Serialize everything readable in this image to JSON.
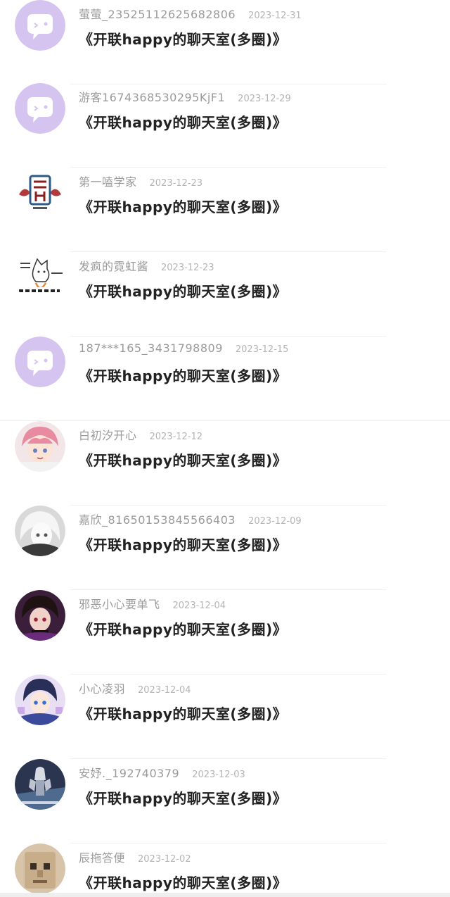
{
  "messages": [
    {
      "username": "萤萤_23525112625682806",
      "date": "2023-12-31",
      "text": "《开联happy的聊天室(多圈)》",
      "avatar": "chat-bubble-icon"
    },
    {
      "username": "游客1674368530295KjF1",
      "date": "2023-12-29",
      "text": "《开联happy的聊天室(多圈)》",
      "avatar": "chat-bubble-icon"
    },
    {
      "username": "第一嗑学家",
      "date": "2023-12-23",
      "text": "《开联happy的聊天室(多圈)》",
      "avatar": "emblem-avatar"
    },
    {
      "username": "发疯的霓虹酱",
      "date": "2023-12-23",
      "text": "《开联happy的聊天室(多圈)》",
      "avatar": "cat-meme-avatar"
    },
    {
      "username": "187***165_3431798809",
      "date": "2023-12-15",
      "text": "《开联happy的聊天室(多圈)》",
      "avatar": "chat-bubble-icon"
    },
    {
      "username": "白初汐开心",
      "date": "2023-12-12",
      "text": "《开联happy的聊天室(多圈)》",
      "avatar": "anime-pink-hair-avatar"
    },
    {
      "username": "嘉欣_81650153845566403",
      "date": "2023-12-09",
      "text": "《开联happy的聊天室(多圈)》",
      "avatar": "anime-white-hair-avatar"
    },
    {
      "username": "邪恶小心要单飞",
      "date": "2023-12-04",
      "text": "《开联happy的聊天室(多圈)》",
      "avatar": "anime-dark-avatar"
    },
    {
      "username": "小心凌羽",
      "date": "2023-12-04",
      "text": "《开联happy的聊天室(多圈)》",
      "avatar": "anime-blue-avatar"
    },
    {
      "username": "安妤._192740379",
      "date": "2023-12-03",
      "text": "《开联happy的聊天室(多圈)》",
      "avatar": "game-character-avatar"
    },
    {
      "username": "辰拖答便",
      "date": "2023-12-02",
      "text": "《开联happy的聊天室(多圈)》",
      "avatar": "cardboard-face-avatar"
    }
  ],
  "colors": {
    "chat_bubble_bg": "#d6c4f0",
    "username": "#9a9a9a",
    "date": "#b4b4b4",
    "message": "#222222"
  }
}
